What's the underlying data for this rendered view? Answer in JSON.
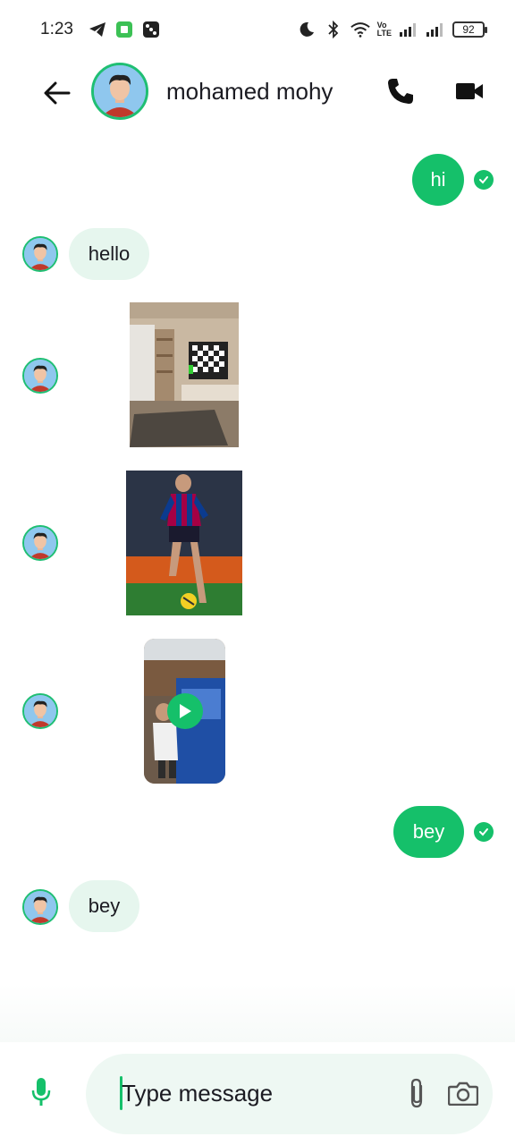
{
  "status_bar": {
    "time": "1:23",
    "volte_label": "Vo\nLTE",
    "battery": "92",
    "left_icons": [
      "telegram-icon",
      "android-app-icon",
      "dice-app-icon"
    ],
    "right_icons": [
      "moon-icon",
      "bluetooth-icon",
      "wifi-icon",
      "signal-icon",
      "signal-icon"
    ]
  },
  "header": {
    "contact_name": "mohamed mohy",
    "icons": [
      "back-arrow-icon",
      "phone-icon",
      "video-camera-icon"
    ]
  },
  "messages": [
    {
      "kind": "text",
      "direction": "outgoing",
      "text": "hi",
      "status": "sent-check"
    },
    {
      "kind": "text",
      "direction": "incoming",
      "text": "hello"
    },
    {
      "kind": "image",
      "direction": "incoming",
      "subject": "room-with-tv"
    },
    {
      "kind": "image",
      "direction": "incoming",
      "subject": "football-player"
    },
    {
      "kind": "video",
      "direction": "incoming",
      "subject": "child-with-box"
    },
    {
      "kind": "text",
      "direction": "outgoing",
      "text": "bey",
      "status": "sent-check"
    },
    {
      "kind": "text",
      "direction": "incoming",
      "text": "bey"
    }
  ],
  "composer": {
    "placeholder": "Type message",
    "icons": [
      "microphone-icon",
      "paperclip-icon",
      "camera-icon"
    ]
  },
  "colors": {
    "accent": "#15c06a",
    "incoming_bubble": "#e6f6ee",
    "composer_bg": "#eef8f3",
    "avatar_bg": "#8fc7ee"
  }
}
